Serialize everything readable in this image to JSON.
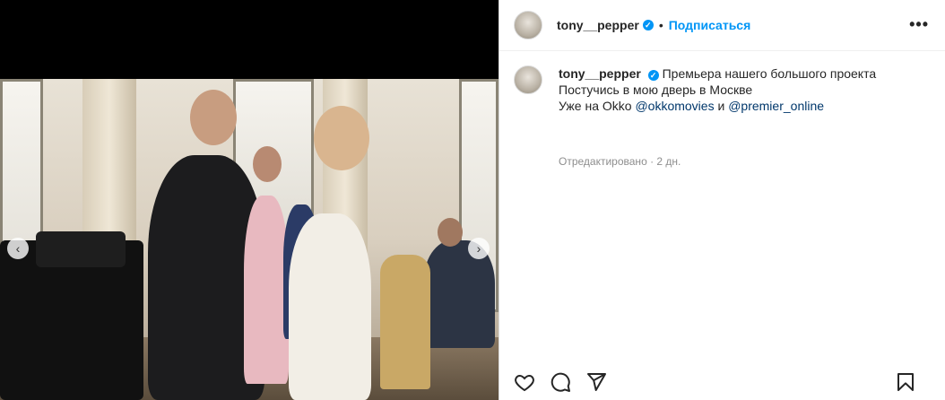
{
  "post": {
    "username": "tony__pepper",
    "verified_mark": "✓",
    "separator": "•",
    "follow_label": "Подписаться",
    "more_label": "•••"
  },
  "caption": {
    "username": "tony__pepper",
    "line1": "Премьера нашего большого проекта",
    "line2": "Постучись в мою дверь в Москве",
    "line3_prefix": "Уже на Okko ",
    "mention1": "@okkomovies",
    "line3_mid": " и ",
    "mention2": "@premier_online",
    "meta": "Отредактировано · 2 дн."
  },
  "media": {
    "prev_arrow": "‹",
    "next_arrow": "›"
  },
  "icons": {
    "like": "heart-icon",
    "comment": "comment-icon",
    "share": "share-icon",
    "save": "bookmark-icon"
  },
  "colors": {
    "accent": "#0095f6",
    "mention": "#00376b",
    "meta": "#8e8e8e"
  }
}
